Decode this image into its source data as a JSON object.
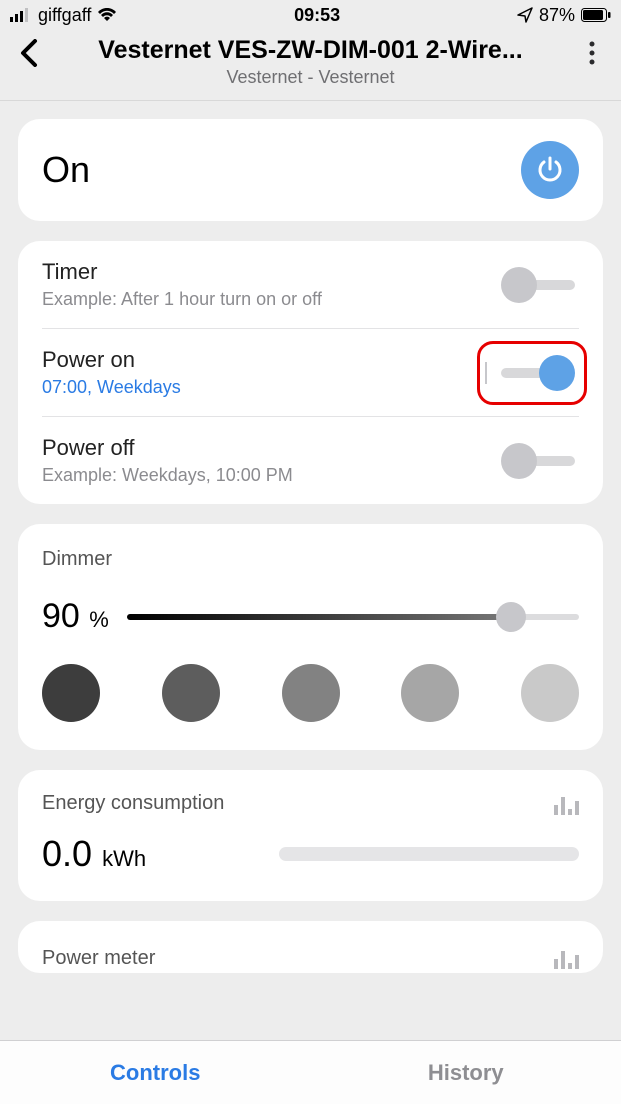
{
  "statusbar": {
    "carrier": "giffgaff",
    "time": "09:53",
    "battery": "87%"
  },
  "header": {
    "title": "Vesternet VES-ZW-DIM-001 2-Wire...",
    "subtitle": "Vesternet - Vesternet"
  },
  "state_card": {
    "state": "On"
  },
  "timer_card": {
    "timer": {
      "label": "Timer",
      "sub": "Example: After 1 hour turn on or off",
      "on": false
    },
    "power_on": {
      "label": "Power on",
      "sub": "07:00, Weekdays",
      "on": true
    },
    "power_off": {
      "label": "Power off",
      "sub": "Example: Weekdays, 10:00 PM",
      "on": false
    }
  },
  "dimmer": {
    "label": "Dimmer",
    "value": "90",
    "unit": "%",
    "presets": [
      "#3d3d3d",
      "#5d5d5d",
      "#828282",
      "#a6a6a6",
      "#c9c9c9"
    ]
  },
  "energy": {
    "label": "Energy consumption",
    "value": "0.0",
    "unit": "kWh"
  },
  "power_meter": {
    "label": "Power meter"
  },
  "tabs": {
    "controls": "Controls",
    "history": "History"
  }
}
